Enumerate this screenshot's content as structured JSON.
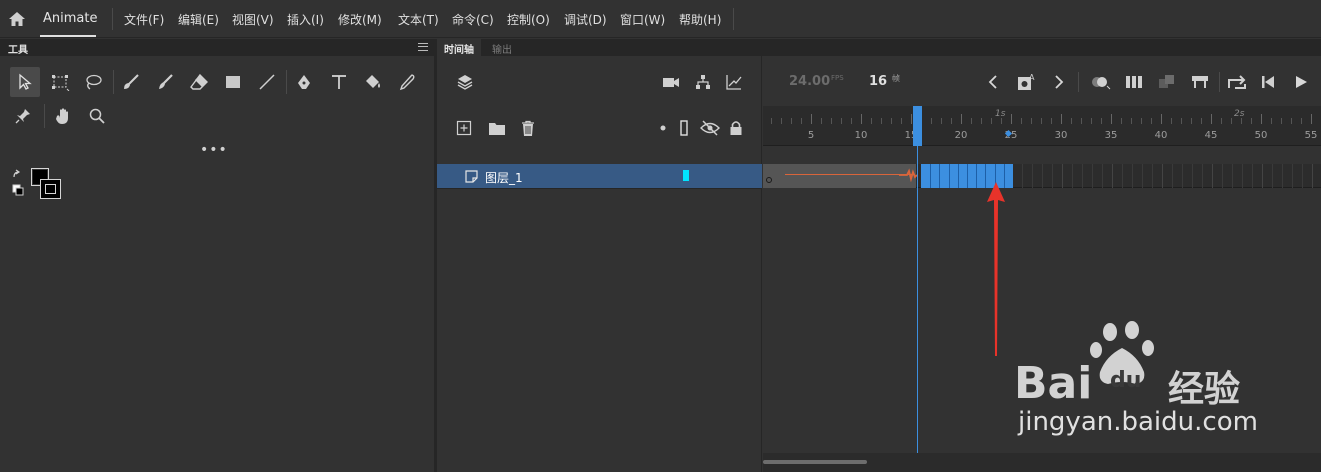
{
  "menubar": {
    "app_name": "Animate",
    "items": [
      "文件(F)",
      "编辑(E)",
      "视图(V)",
      "插入(I)",
      "修改(M)",
      "文本(T)",
      "命令(C)",
      "控制(O)",
      "调试(D)",
      "窗口(W)",
      "帮助(H)"
    ]
  },
  "tools": {
    "tab_label": "工具",
    "icons": [
      "selection-tool-icon",
      "free-transform-tool-icon",
      "lasso-tool-icon",
      "paint-brush-icon",
      "brush-tool-icon",
      "eraser-tool-icon",
      "rectangle-tool-icon",
      "line-tool-icon",
      "pen-tool-icon",
      "text-tool-icon",
      "paint-bucket-icon",
      "eyedropper-icon",
      "pin-tool-icon",
      "hand-tool-icon",
      "zoom-tool-icon"
    ],
    "more": "•••",
    "stroke_color": "#000000",
    "fill_color": "#000000"
  },
  "timeline": {
    "tabs": [
      "时间轴",
      "输出"
    ],
    "fps_value": "24.00",
    "fps_unit": "FPS",
    "current_frame": "16",
    "frame_unit": "帧",
    "ruler_seconds": [
      "1s",
      "2s"
    ],
    "ruler_ticks": [
      "5",
      "10",
      "15",
      "20",
      "25",
      "30",
      "35",
      "40",
      "45",
      "50",
      "55"
    ],
    "layer": {
      "name": "图层_1",
      "color": "#00e5ff"
    },
    "selected_frames": {
      "start": 16,
      "end": 25
    },
    "playhead_frame": 16,
    "accent_color": "#3c8fe0",
    "tween_color": "#d9653b"
  },
  "watermark": {
    "brand": "Bai",
    "brand_suffix": "du",
    "brand_cn": "经验",
    "url": "jingyan.baidu.com"
  }
}
